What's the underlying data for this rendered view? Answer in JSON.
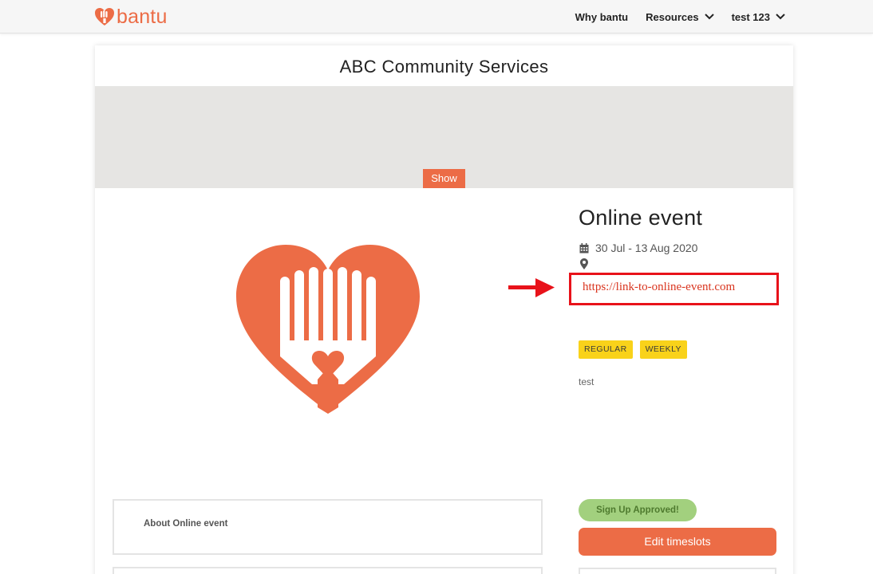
{
  "nav": {
    "logo_text": "bantu",
    "items": [
      {
        "label": "Why bantu",
        "has_dropdown": false
      },
      {
        "label": "Resources",
        "has_dropdown": true
      },
      {
        "label": "test 123",
        "has_dropdown": true
      }
    ]
  },
  "org": {
    "title": "ABC Community Services"
  },
  "banner": {
    "show_label": "Show"
  },
  "event": {
    "title": "Online event",
    "date_range": "30 Jul - 13 Aug 2020",
    "link": "https://link-to-online-event.com",
    "tags": [
      "REGULAR",
      "WEEKLY"
    ],
    "description": "test"
  },
  "about": {
    "label": "About Online event"
  },
  "signup": {
    "status": "Sign Up Approved!",
    "edit_label": "Edit timeslots"
  },
  "colors": {
    "brand": "#ec6c46",
    "tag": "#f9d21a",
    "approved": "#a2d07e",
    "annotation": "#e8121a"
  },
  "icons": {
    "date": "calendar-icon",
    "location": "map-pin-icon",
    "annotation": "arrow-right-icon"
  }
}
